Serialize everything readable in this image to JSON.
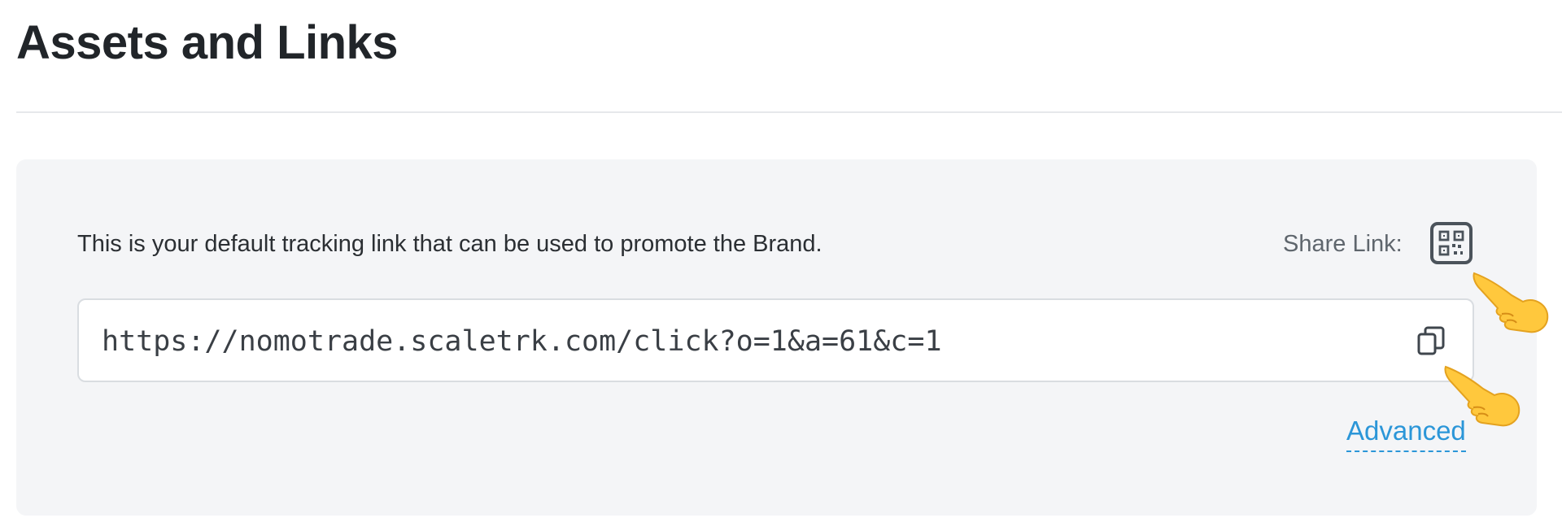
{
  "header": {
    "title": "Assets and Links"
  },
  "tracking_card": {
    "description": "This is your default tracking link that can be used to promote the Brand.",
    "share_label": "Share Link:",
    "tracking_link": "https://nomotrade.scaletrk.com/click?o=1&a=61&c=1",
    "advanced_label": "Advanced"
  },
  "icons": {
    "qr": "qr-code-icon",
    "copy": "copy-icon",
    "pointer": "pointing-hand-icon"
  },
  "colors": {
    "link_accent": "#2b96d8",
    "card_background": "#f4f5f7",
    "icon_stroke": "#4b535b"
  }
}
